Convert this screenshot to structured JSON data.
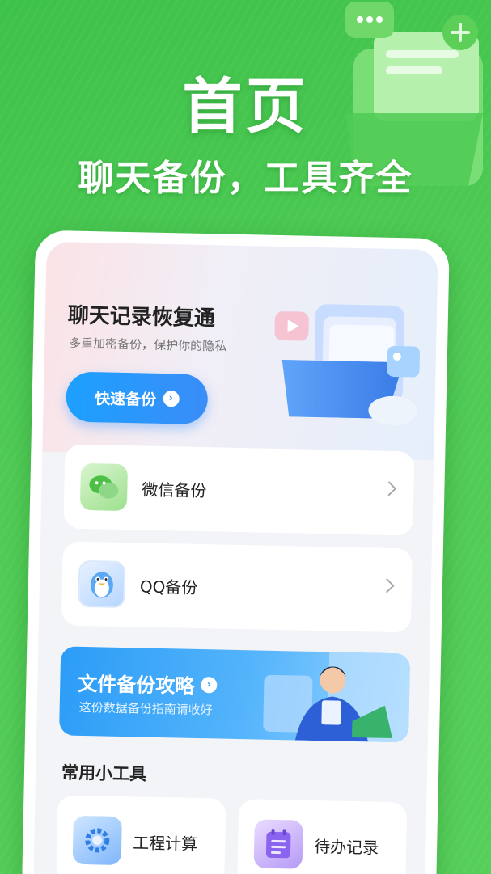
{
  "hero": {
    "title": "首页",
    "subtitle": "聊天备份，工具齐全"
  },
  "banner": {
    "title": "聊天记录恢复通",
    "description": "多重加密备份，保护你的隐私",
    "button_label": "快速备份"
  },
  "backup_items": [
    {
      "label": "微信备份",
      "icon": "wechat-icon"
    },
    {
      "label": "QQ备份",
      "icon": "qq-penguin-icon"
    }
  ],
  "guide": {
    "title": "文件备份攻略",
    "description": "这份数据备份指南请收好"
  },
  "tools": {
    "section_title": "常用小工具",
    "items": [
      {
        "label": "工程计算",
        "icon": "gear-calc-icon"
      },
      {
        "label": "待办记录",
        "icon": "todo-list-icon"
      }
    ]
  },
  "colors": {
    "brand_green": "#4cc955",
    "accent_blue": "#2b92fb"
  }
}
